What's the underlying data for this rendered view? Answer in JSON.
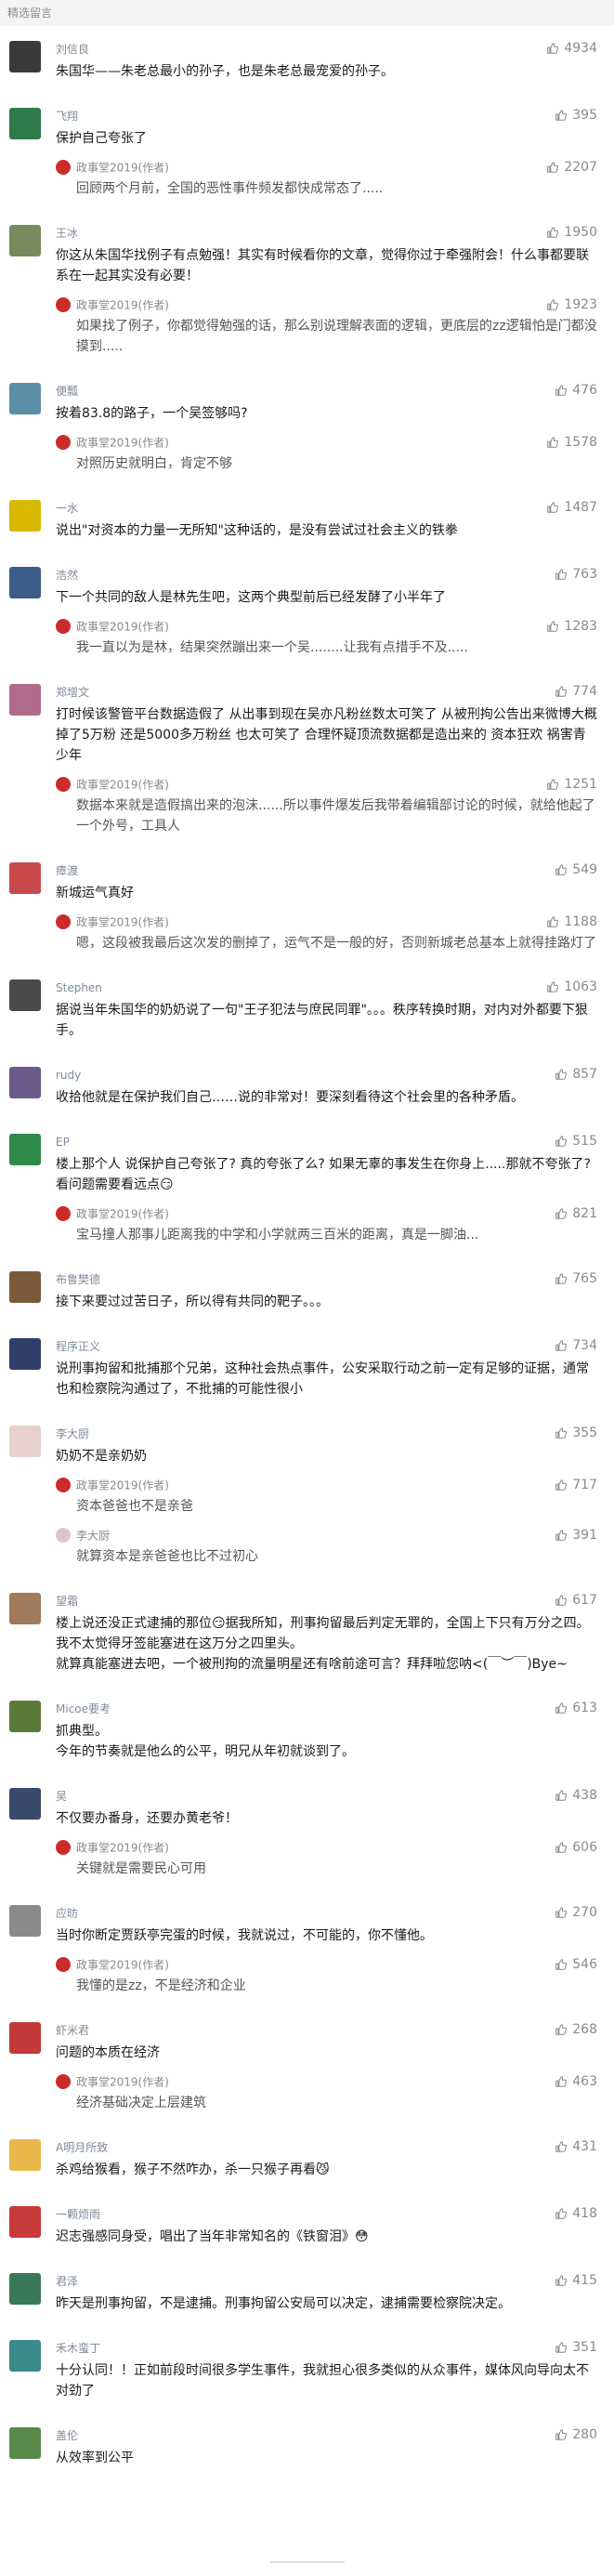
{
  "section_title": "精选留言",
  "author_name": "政事堂2019(作者)",
  "comments": [
    {
      "name": "刘信良",
      "likes": "4934",
      "avatar_color": "#3a3a3a",
      "text": "朱国华——朱老总最小的孙子，也是朱老总最宠爱的孙子。"
    },
    {
      "name": "飞翔",
      "likes": "395",
      "avatar_color": "#2f7a4b",
      "text": "保护自己夸张了",
      "reply": {
        "likes": "2207",
        "text": "回顾两个月前，全国的恶性事件频发都快成常态了....."
      }
    },
    {
      "name": "王冰",
      "likes": "1950",
      "avatar_color": "#7a8a5c",
      "text": "你这从朱国华找例子有点勉强！其实有时候看你的文章，觉得你过于牵强附会！什么事都要联系在一起其实没有必要！",
      "reply": {
        "likes": "1923",
        "text": "如果找了例子，你都觉得勉强的话，那么别说理解表面的逻辑，更底层的zz逻辑怕是门都没摸到....."
      }
    },
    {
      "name": "便瓢",
      "likes": "476",
      "avatar_color": "#5b8fa8",
      "text": "按着83.8的路子，一个吴签够吗?",
      "reply": {
        "likes": "1578",
        "text": "对照历史就明白，肯定不够"
      }
    },
    {
      "name": "一水",
      "likes": "1487",
      "avatar_color": "#d8b800",
      "text": "说出\"对资本的力量一无所知\"这种话的，是没有尝试过社会主义的铁拳"
    },
    {
      "name": "浩然",
      "likes": "763",
      "avatar_color": "#3c5d8a",
      "text": "下一个共同的敌人是林先生吧，这两个典型前后已经发酵了小半年了",
      "reply": {
        "likes": "1283",
        "text": "我一直以为是林，结果突然蹦出来一个吴........让我有点措手不及....."
      }
    },
    {
      "name": "郑增文",
      "likes": "774",
      "avatar_color": "#b06a8a",
      "text": "打时候该警管平台数据造假了 从出事到现在吴亦凡粉丝数太可笑了 从被刑拘公告出来微博大概掉了5万粉 还是5000多万粉丝 也太可笑了 合理怀疑顶流数据都是造出来的 资本狂欢 祸害青少年",
      "reply": {
        "likes": "1251",
        "text": "数据本来就是造假搞出来的泡沫......所以事件爆发后我带着编辑部讨论的时候，就给他起了一个外号，工具人"
      }
    },
    {
      "name": "瘴渡",
      "likes": "549",
      "avatar_color": "#c94a4a",
      "text": "新城运气真好",
      "reply": {
        "likes": "1188",
        "text": "嗯，这段被我最后这次发的删掉了，运气不是一般的好，否则新城老总基本上就得挂路灯了"
      }
    },
    {
      "name": "Stephen",
      "likes": "1063",
      "avatar_color": "#4a4a4a",
      "text": "据说当年朱国华的奶奶说了一句\"王子犯法与庶民同罪\"。。。秩序转换时期，对内对外都要下狠手。"
    },
    {
      "name": "rudy",
      "likes": "857",
      "avatar_color": "#6a5a8a",
      "text": "收拾他就是在保护我们自己……说的非常对！要深刻看待这个社会里的各种矛盾。"
    },
    {
      "name": "EP",
      "likes": "515",
      "avatar_color": "#2f8a4b",
      "text": "楼上那个人 说保护自己夸张了?  真的夸张了么? 如果无辜的事发生在你身上.....那就不夸张了? 看问题需要看远点😏",
      "reply": {
        "likes": "821",
        "text": "宝马撞人那事儿距离我的中学和小学就两三百米的距离，真是一脚油..."
      }
    },
    {
      "name": "布鲁樊德",
      "likes": "765",
      "avatar_color": "#7a5a3a",
      "text": "接下来要过过苦日子，所以得有共同的靶子。。。"
    },
    {
      "name": "程序正义",
      "likes": "734",
      "avatar_color": "#2f3f6a",
      "text": "说刑事拘留和批捕那个兄弟，这种社会热点事件，公安采取行动之前一定有足够的证据，通常也和检察院沟通过了，不批捕的可能性很小"
    },
    {
      "name": "李大厨",
      "likes": "355",
      "avatar_color": "#e8d0d0",
      "text": "奶奶不是亲奶奶",
      "reply": {
        "likes": "717",
        "text": "资本爸爸也不是亲爸"
      },
      "sub": {
        "name": "李大厨",
        "likes": "391",
        "text": "就算资本是亲爸爸也比不过初心"
      }
    },
    {
      "name": "望霜",
      "likes": "617",
      "avatar_color": "#a07a5a",
      "text": "楼上说还没正式逮捕的那位😏据我所知，刑事拘留最后判定无罪的，全国上下只有万分之四。我不太觉得牙签能塞进在这万分之四里头。\n就算真能塞进去吧，一个被刑拘的流量明星还有啥前途可言？拜拜啦您呐<(￣︶￣)Bye~"
    },
    {
      "name": "Micoe要考",
      "likes": "613",
      "avatar_color": "#5a7a3a",
      "text": "抓典型。\n今年的节奏就是他么的公平，明兄从年初就谈到了。"
    },
    {
      "name": "吴",
      "likes": "438",
      "avatar_color": "#3a4a6a",
      "text": "不仅要办番身，还要办黄老爷！",
      "reply": {
        "likes": "606",
        "text": "关键就是需要民心可用"
      }
    },
    {
      "name": "应昉",
      "likes": "270",
      "avatar_color": "#8a8a8a",
      "text": "当时你断定贾跃亭完蛋的时候，我就说过，不可能的，你不懂他。",
      "reply": {
        "likes": "546",
        "text": "我懂的是zz，不是经济和企业"
      }
    },
    {
      "name": "虾米君",
      "likes": "268",
      "avatar_color": "#c23a3a",
      "text": "问题的本质在经济",
      "reply": {
        "likes": "463",
        "text": "经济基础决定上层建筑"
      }
    },
    {
      "name": "A明月所致",
      "likes": "431",
      "avatar_color": "#e8b84a",
      "text": "杀鸡给猴看，猴子不然咋办，杀一只猴子再看😼"
    },
    {
      "name": "一颗烦雨",
      "likes": "418",
      "avatar_color": "#c83a3a",
      "text": "迟志强感同身受，唱出了当年非常知名的《铁窗泪》😳"
    },
    {
      "name": "君泽",
      "likes": "415",
      "avatar_color": "#3a7a5a",
      "text": "昨天是刑事拘留，不是逮捕。刑事拘留公安局可以决定，逮捕需要检察院决定。"
    },
    {
      "name": "禾木蛮丁",
      "likes": "351",
      "avatar_color": "#3a8a8a",
      "text": "十分认同！！正如前段时间很多学生事件，我就担心很多类似的从众事件，媒体风向导向太不对劲了"
    },
    {
      "name": "盖伦",
      "likes": "280",
      "avatar_color": "#5a8a4a",
      "text": "从效率到公平"
    }
  ]
}
